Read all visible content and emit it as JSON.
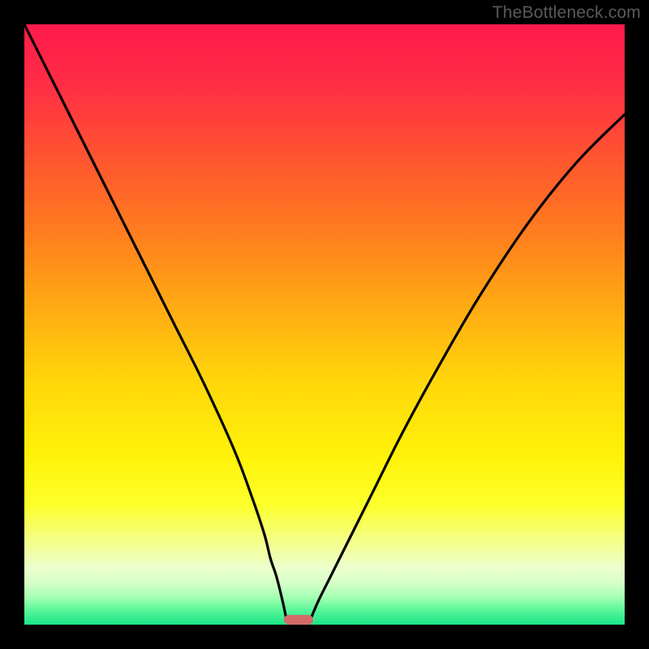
{
  "watermark": "TheBottleneck.com",
  "colors": {
    "black": "#000000",
    "curve": "#000000",
    "marker": "#d46a6a",
    "gradient_stops": [
      {
        "offset": 0.0,
        "color": "#ff1a4c"
      },
      {
        "offset": 0.1,
        "color": "#ff2d44"
      },
      {
        "offset": 0.22,
        "color": "#ff5430"
      },
      {
        "offset": 0.35,
        "color": "#ff7e1e"
      },
      {
        "offset": 0.48,
        "color": "#ffae12"
      },
      {
        "offset": 0.6,
        "color": "#ffd80a"
      },
      {
        "offset": 0.72,
        "color": "#fff208"
      },
      {
        "offset": 0.8,
        "color": "#fcff2a"
      },
      {
        "offset": 0.86,
        "color": "#f4ff88"
      },
      {
        "offset": 0.905,
        "color": "#ecffcc"
      },
      {
        "offset": 0.93,
        "color": "#d6ffc8"
      },
      {
        "offset": 0.955,
        "color": "#a3ffb2"
      },
      {
        "offset": 0.975,
        "color": "#5cf79a"
      },
      {
        "offset": 1.0,
        "color": "#19e586"
      }
    ]
  },
  "chart_data": {
    "type": "line",
    "title": "",
    "xlabel": "",
    "ylabel": "",
    "xlim": [
      0,
      100
    ],
    "ylim": [
      0,
      100
    ],
    "series": [
      {
        "name": "left-curve",
        "x": [
          0,
          5,
          10,
          15,
          20,
          25,
          30,
          35,
          38,
          40,
          41,
          42,
          43,
          43.6
        ],
        "y": [
          100,
          90,
          80,
          70,
          60,
          50,
          40,
          29,
          21,
          15,
          11,
          8,
          4,
          1.2
        ]
      },
      {
        "name": "right-curve",
        "x": [
          47.8,
          49,
          51,
          54,
          58,
          63,
          69,
          76,
          84,
          92,
          100
        ],
        "y": [
          1.2,
          4,
          8,
          14,
          22,
          32,
          43,
          55,
          67,
          77,
          85
        ]
      }
    ],
    "marker": {
      "x_center": 45.7,
      "width": 4.8,
      "y": 0,
      "height": 1.6
    }
  }
}
